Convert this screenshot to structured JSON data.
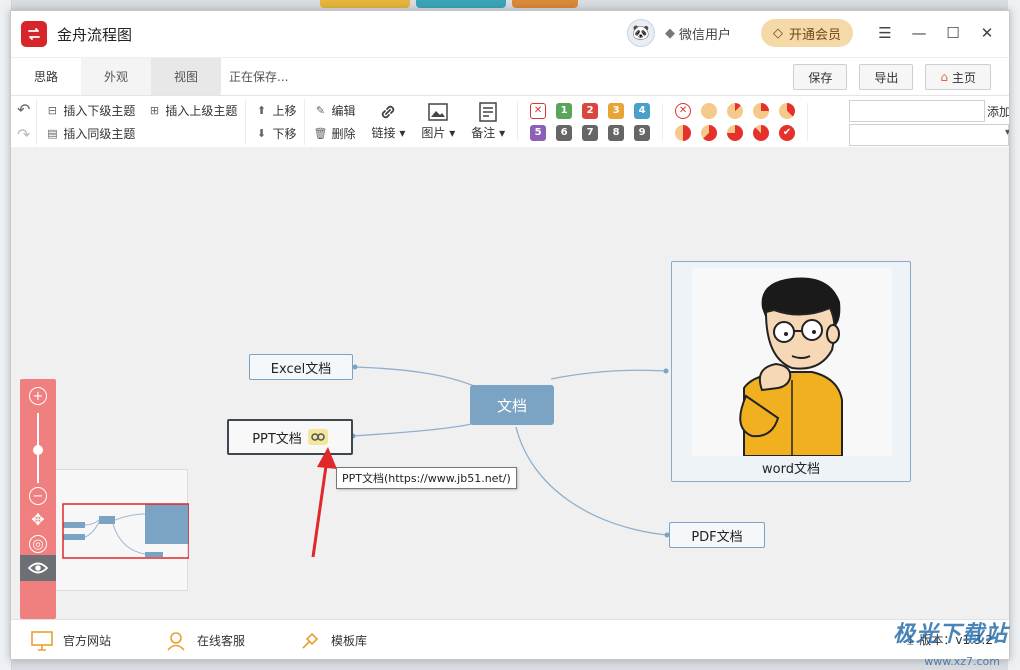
{
  "app": {
    "title": "金舟流程图",
    "user_name": "微信用户",
    "vip_label": "开通会员"
  },
  "tabs": [
    {
      "label": "思路"
    },
    {
      "label": "外观"
    },
    {
      "label": "视图"
    }
  ],
  "status": {
    "saving": "正在保存..."
  },
  "tab_actions": {
    "save": "保存",
    "export": "导出",
    "home": "主页"
  },
  "toolbar": {
    "insert_child": "插入下级主题",
    "insert_parent": "插入上级主题",
    "insert_sibling": "插入同级主题",
    "move_up": "上移",
    "move_down": "下移",
    "edit": "编辑",
    "delete": "删除",
    "link": "链接",
    "image": "图片",
    "note": "备注",
    "add": "添加",
    "priority_badges": [
      "1",
      "2",
      "3",
      "4",
      "5",
      "6",
      "7",
      "8",
      "9"
    ]
  },
  "canvas": {
    "center_node": "文档",
    "node_excel": "Excel文档",
    "node_ppt": "PPT文档",
    "node_word": "word文档",
    "node_pdf": "PDF文档",
    "tooltip": "PPT文档(https://www.jb51.net/)"
  },
  "bottom": {
    "official_site": "官方网站",
    "support": "在线客服",
    "templates": "模板库",
    "version": "版本：v1.3.2"
  },
  "watermark": {
    "name": "极光下载站",
    "url": "www.xz7.com"
  },
  "colors": {
    "accent_red": "#d7262b",
    "node_blue": "#7aa3c4",
    "zoom_panel": "#f07f80",
    "vip_gold": "#f6d9a8"
  }
}
